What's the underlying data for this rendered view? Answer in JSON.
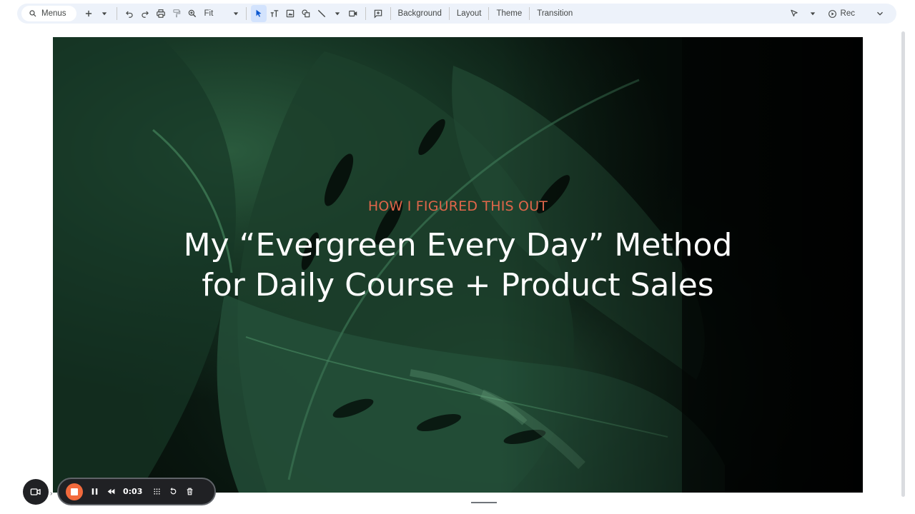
{
  "toolbar": {
    "menus_label": "Menus",
    "zoom_value": "Fit",
    "background_label": "Background",
    "layout_label": "Layout",
    "theme_label": "Theme",
    "transition_label": "Transition",
    "rec_label": "Rec"
  },
  "slide": {
    "subtitle": "HOW I FIGURED THIS OUT",
    "title_line1": "My “Evergreen Every Day” Method",
    "title_line2": "for Daily Course + Product Sales",
    "subtitle_color": "#e0664a",
    "title_color": "#ffffff"
  },
  "recorder": {
    "time": "0:03",
    "stop_color": "#f26a3d"
  },
  "colors": {
    "accent": "#0b57d0",
    "toolbar_bg": "#edf2fa"
  }
}
